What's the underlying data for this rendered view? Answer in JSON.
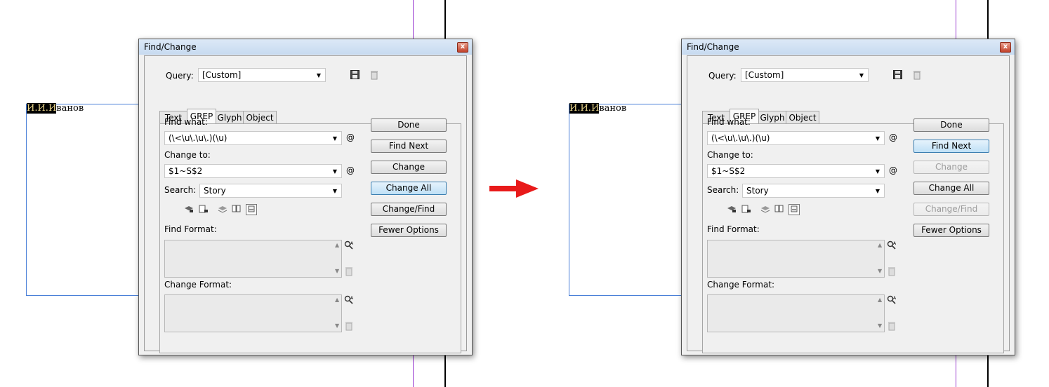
{
  "document": {
    "highlighted_text": "И.И.И",
    "rest_text": "ванов"
  },
  "dialog": {
    "title": "Find/Change",
    "close_glyph": "x",
    "query_label": "Query:",
    "query_value": "[Custom]",
    "tabs": [
      "Text",
      "GREP",
      "Glyph",
      "Object"
    ],
    "active_tab": "GREP",
    "find_what_label": "Find what:",
    "find_what_value": "(\\<\\u\\.\\u\\.)(\\u)",
    "change_to_label": "Change to:",
    "change_to_value": "$1~S$2",
    "search_label": "Search:",
    "search_value": "Story",
    "find_format_label": "Find Format:",
    "change_format_label": "Change Format:",
    "special_char_glyph": "@",
    "buttons": {
      "done": "Done",
      "find_next": "Find Next",
      "change": "Change",
      "change_all": "Change All",
      "change_find": "Change/Find",
      "fewer_options": "Fewer Options"
    }
  },
  "states": {
    "before": {
      "hover_button": "Change All",
      "disabled_buttons": []
    },
    "after": {
      "hover_button": "Find Next",
      "disabled_buttons": [
        "Change",
        "Change/Find"
      ]
    }
  },
  "colors": {
    "arrow": "#e81a1a",
    "frame_line": "#4a80d8",
    "guide_purple": "#9b3fd1",
    "button_hover": "#bfe0f6",
    "highlight_text": "#e8d48a"
  },
  "icons": [
    "save-query-icon",
    "delete-query-icon",
    "special-characters-icon",
    "include-locked-layers-icon",
    "include-locked-stories-icon",
    "include-hidden-layers-icon",
    "include-master-pages-icon",
    "include-footnotes-icon",
    "specify-attributes-icon",
    "clear-attributes-icon",
    "right-arrow-icon"
  ]
}
